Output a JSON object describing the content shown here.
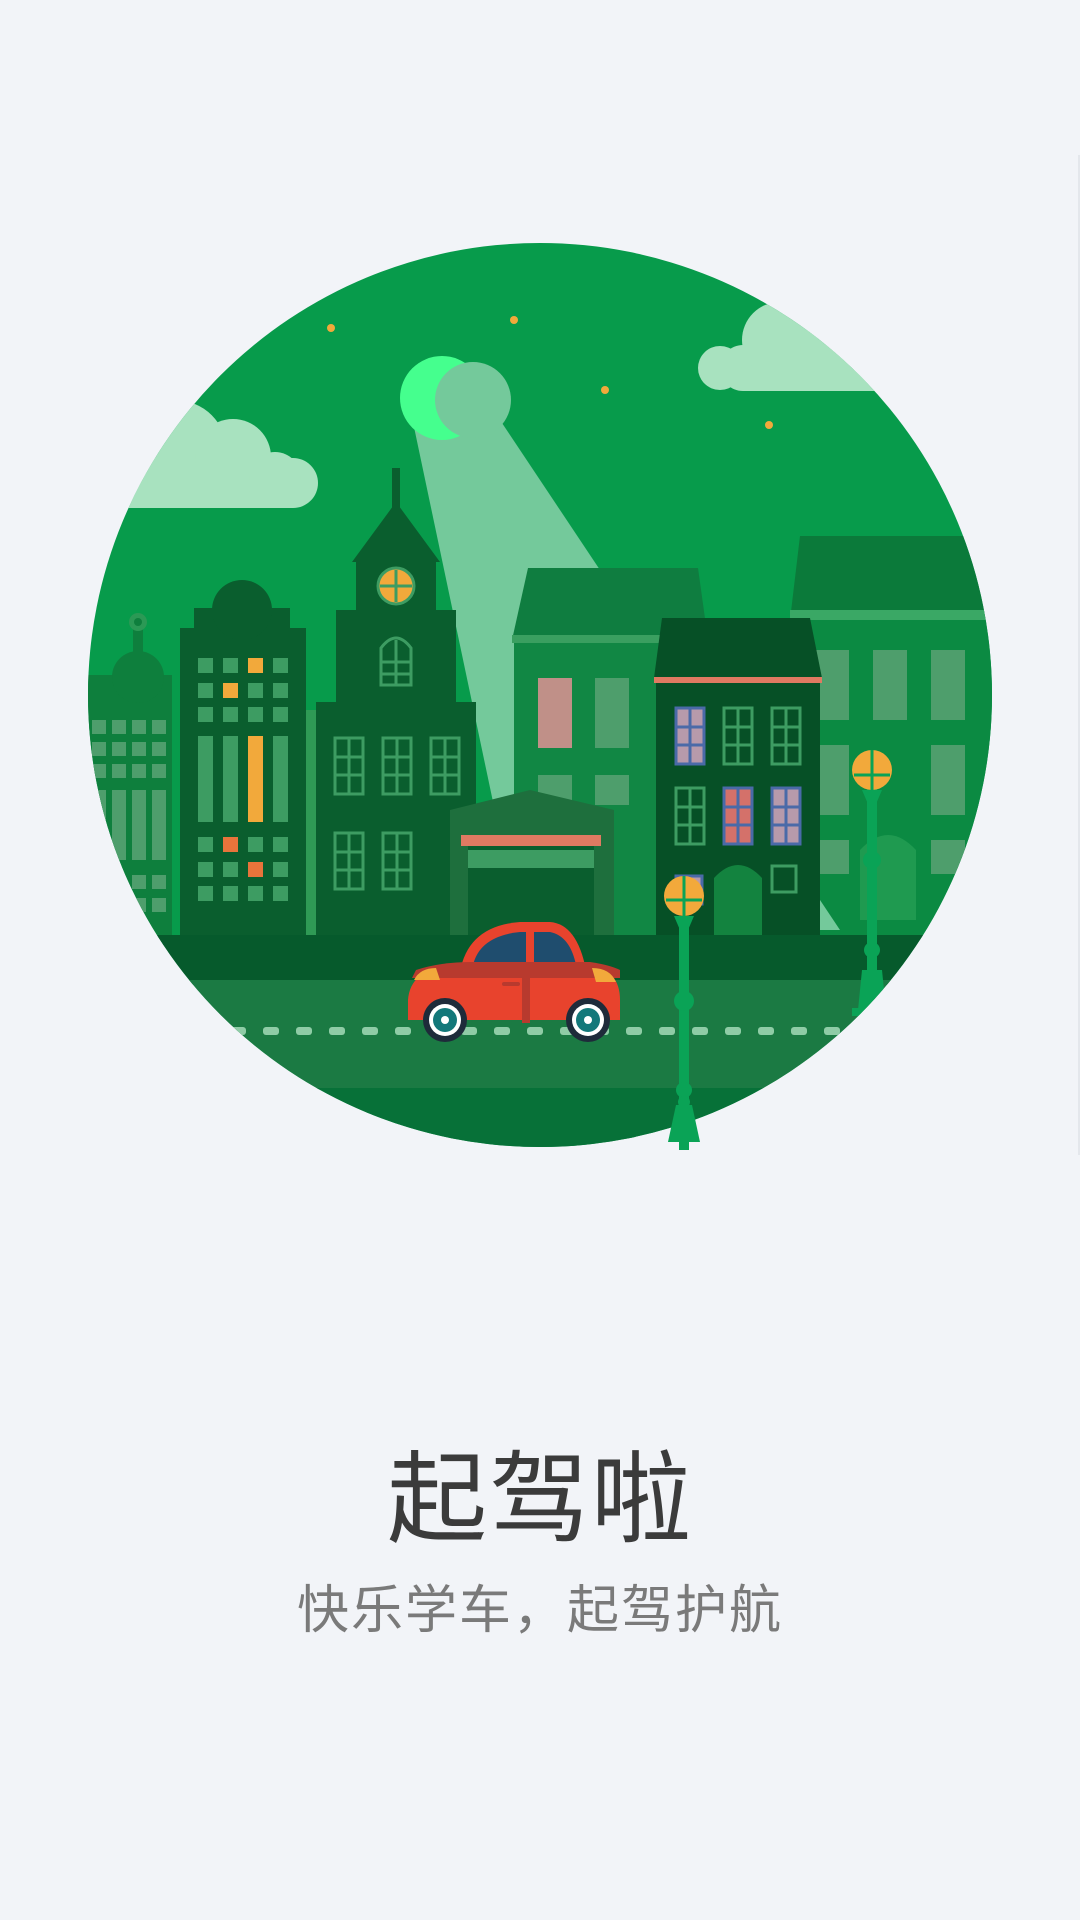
{
  "splash": {
    "title": "起驾啦",
    "slogan": "快乐学车，起驾护航",
    "illustration_icon": "city-night-car-illustration"
  },
  "colors": {
    "background": "#f2f4f8",
    "circle_green": "#079b4b",
    "dark_green": "#055a2c",
    "car_red": "#e8432d",
    "lamp_yellow": "#f2a93b",
    "moon_green": "#45ff8e",
    "cloud": "#a8e2bf",
    "title_text": "#3b3b3b",
    "slogan_text": "#7a7a7a"
  }
}
